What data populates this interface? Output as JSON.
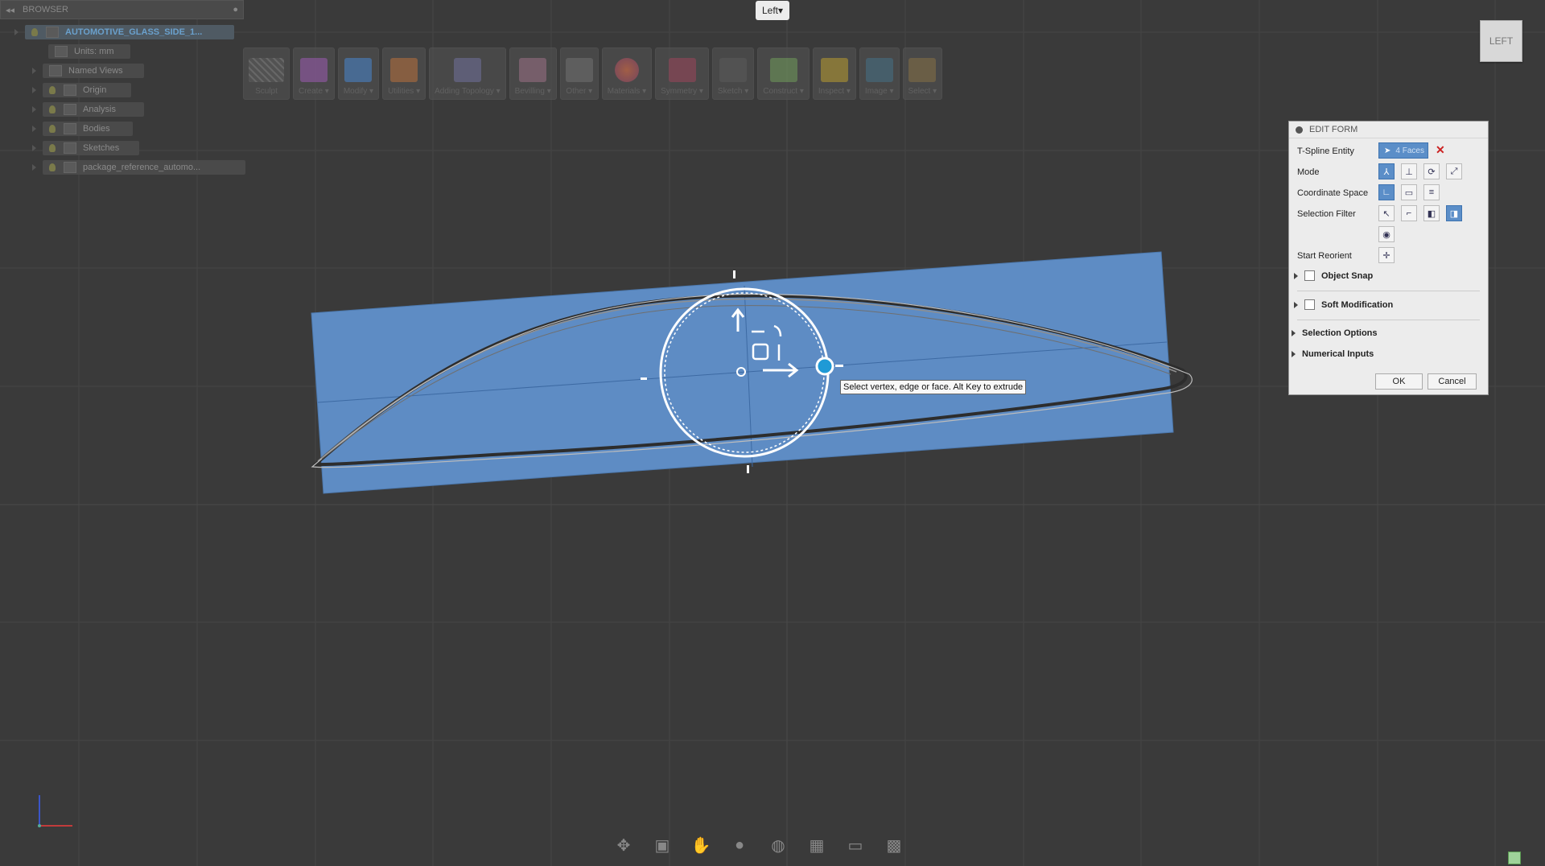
{
  "browser": {
    "title": "BROWSER",
    "items": [
      {
        "label": "AUTOMOTIVE_GLASS_SIDE_1..."
      },
      {
        "label": "Units: mm"
      },
      {
        "label": "Named Views"
      },
      {
        "label": "Origin"
      },
      {
        "label": "Analysis"
      },
      {
        "label": "Bodies"
      },
      {
        "label": "Sketches"
      },
      {
        "label": "package_reference_automo..."
      }
    ]
  },
  "view_dropdown": {
    "label": "Left▾"
  },
  "view_cube": {
    "label": "LEFT"
  },
  "toolbar": {
    "groups": [
      {
        "label": "Sculpt",
        "icon": "sculpt-icon"
      },
      {
        "label": "Create ▾",
        "icon": "create-icon"
      },
      {
        "label": "Modify ▾",
        "icon": "modify-icon"
      },
      {
        "label": "Utilities ▾",
        "icon": "utilities-icon"
      },
      {
        "label": "Adding Topology ▾",
        "icon": "topology-icon"
      },
      {
        "label": "Bevilling ▾",
        "icon": "bevel-icon"
      },
      {
        "label": "Other ▾",
        "icon": "other-icon"
      },
      {
        "label": "Materials ▾",
        "icon": "materials-icon"
      },
      {
        "label": "Symmetry ▾",
        "icon": "symmetry-icon"
      },
      {
        "label": "Sketch ▾",
        "icon": "sketch-icon"
      },
      {
        "label": "Construct ▾",
        "icon": "construct-icon"
      },
      {
        "label": "Inspect ▾",
        "icon": "inspect-icon"
      },
      {
        "label": "Image ▾",
        "icon": "image-icon"
      },
      {
        "label": "Select ▾",
        "icon": "select-icon"
      }
    ]
  },
  "edit_form": {
    "title": "EDIT FORM",
    "tspline_label": "T-Spline Entity",
    "tspline_value": "4 Faces",
    "mode_label": "Mode",
    "coord_label": "Coordinate Space",
    "filter_label": "Selection Filter",
    "reorient_label": "Start Reorient",
    "object_snap": "Object Snap",
    "soft_mod": "Soft Modification",
    "selection_options": "Selection Options",
    "numerical_inputs": "Numerical Inputs",
    "ok": "OK",
    "cancel": "Cancel"
  },
  "tooltip": "Select vertex, edge or face. Alt Key to extrude",
  "colors": {
    "viewport_bg": "#3a3a3a",
    "surface_fill": "#5e8cc4",
    "accent_blue": "#1f9ad6"
  }
}
